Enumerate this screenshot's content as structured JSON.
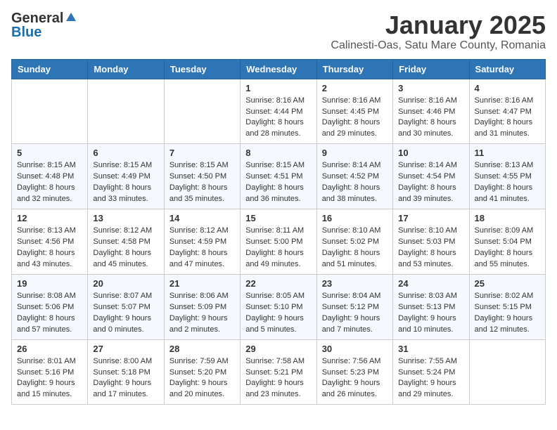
{
  "header": {
    "logo_general": "General",
    "logo_blue": "Blue",
    "month": "January 2025",
    "location": "Calinesti-Oas, Satu Mare County, Romania"
  },
  "weekdays": [
    "Sunday",
    "Monday",
    "Tuesday",
    "Wednesday",
    "Thursday",
    "Friday",
    "Saturday"
  ],
  "weeks": [
    [
      {
        "day": "",
        "info": ""
      },
      {
        "day": "",
        "info": ""
      },
      {
        "day": "",
        "info": ""
      },
      {
        "day": "1",
        "info": "Sunrise: 8:16 AM\nSunset: 4:44 PM\nDaylight: 8 hours\nand 28 minutes."
      },
      {
        "day": "2",
        "info": "Sunrise: 8:16 AM\nSunset: 4:45 PM\nDaylight: 8 hours\nand 29 minutes."
      },
      {
        "day": "3",
        "info": "Sunrise: 8:16 AM\nSunset: 4:46 PM\nDaylight: 8 hours\nand 30 minutes."
      },
      {
        "day": "4",
        "info": "Sunrise: 8:16 AM\nSunset: 4:47 PM\nDaylight: 8 hours\nand 31 minutes."
      }
    ],
    [
      {
        "day": "5",
        "info": "Sunrise: 8:15 AM\nSunset: 4:48 PM\nDaylight: 8 hours\nand 32 minutes."
      },
      {
        "day": "6",
        "info": "Sunrise: 8:15 AM\nSunset: 4:49 PM\nDaylight: 8 hours\nand 33 minutes."
      },
      {
        "day": "7",
        "info": "Sunrise: 8:15 AM\nSunset: 4:50 PM\nDaylight: 8 hours\nand 35 minutes."
      },
      {
        "day": "8",
        "info": "Sunrise: 8:15 AM\nSunset: 4:51 PM\nDaylight: 8 hours\nand 36 minutes."
      },
      {
        "day": "9",
        "info": "Sunrise: 8:14 AM\nSunset: 4:52 PM\nDaylight: 8 hours\nand 38 minutes."
      },
      {
        "day": "10",
        "info": "Sunrise: 8:14 AM\nSunset: 4:54 PM\nDaylight: 8 hours\nand 39 minutes."
      },
      {
        "day": "11",
        "info": "Sunrise: 8:13 AM\nSunset: 4:55 PM\nDaylight: 8 hours\nand 41 minutes."
      }
    ],
    [
      {
        "day": "12",
        "info": "Sunrise: 8:13 AM\nSunset: 4:56 PM\nDaylight: 8 hours\nand 43 minutes."
      },
      {
        "day": "13",
        "info": "Sunrise: 8:12 AM\nSunset: 4:58 PM\nDaylight: 8 hours\nand 45 minutes."
      },
      {
        "day": "14",
        "info": "Sunrise: 8:12 AM\nSunset: 4:59 PM\nDaylight: 8 hours\nand 47 minutes."
      },
      {
        "day": "15",
        "info": "Sunrise: 8:11 AM\nSunset: 5:00 PM\nDaylight: 8 hours\nand 49 minutes."
      },
      {
        "day": "16",
        "info": "Sunrise: 8:10 AM\nSunset: 5:02 PM\nDaylight: 8 hours\nand 51 minutes."
      },
      {
        "day": "17",
        "info": "Sunrise: 8:10 AM\nSunset: 5:03 PM\nDaylight: 8 hours\nand 53 minutes."
      },
      {
        "day": "18",
        "info": "Sunrise: 8:09 AM\nSunset: 5:04 PM\nDaylight: 8 hours\nand 55 minutes."
      }
    ],
    [
      {
        "day": "19",
        "info": "Sunrise: 8:08 AM\nSunset: 5:06 PM\nDaylight: 8 hours\nand 57 minutes."
      },
      {
        "day": "20",
        "info": "Sunrise: 8:07 AM\nSunset: 5:07 PM\nDaylight: 9 hours\nand 0 minutes."
      },
      {
        "day": "21",
        "info": "Sunrise: 8:06 AM\nSunset: 5:09 PM\nDaylight: 9 hours\nand 2 minutes."
      },
      {
        "day": "22",
        "info": "Sunrise: 8:05 AM\nSunset: 5:10 PM\nDaylight: 9 hours\nand 5 minutes."
      },
      {
        "day": "23",
        "info": "Sunrise: 8:04 AM\nSunset: 5:12 PM\nDaylight: 9 hours\nand 7 minutes."
      },
      {
        "day": "24",
        "info": "Sunrise: 8:03 AM\nSunset: 5:13 PM\nDaylight: 9 hours\nand 10 minutes."
      },
      {
        "day": "25",
        "info": "Sunrise: 8:02 AM\nSunset: 5:15 PM\nDaylight: 9 hours\nand 12 minutes."
      }
    ],
    [
      {
        "day": "26",
        "info": "Sunrise: 8:01 AM\nSunset: 5:16 PM\nDaylight: 9 hours\nand 15 minutes."
      },
      {
        "day": "27",
        "info": "Sunrise: 8:00 AM\nSunset: 5:18 PM\nDaylight: 9 hours\nand 17 minutes."
      },
      {
        "day": "28",
        "info": "Sunrise: 7:59 AM\nSunset: 5:20 PM\nDaylight: 9 hours\nand 20 minutes."
      },
      {
        "day": "29",
        "info": "Sunrise: 7:58 AM\nSunset: 5:21 PM\nDaylight: 9 hours\nand 23 minutes."
      },
      {
        "day": "30",
        "info": "Sunrise: 7:56 AM\nSunset: 5:23 PM\nDaylight: 9 hours\nand 26 minutes."
      },
      {
        "day": "31",
        "info": "Sunrise: 7:55 AM\nSunset: 5:24 PM\nDaylight: 9 hours\nand 29 minutes."
      },
      {
        "day": "",
        "info": ""
      }
    ]
  ]
}
